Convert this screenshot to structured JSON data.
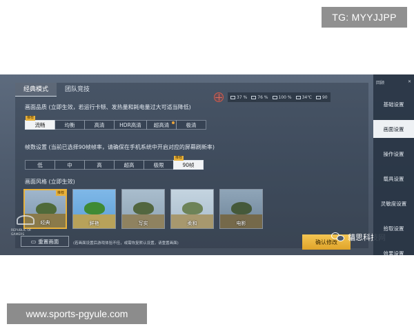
{
  "overlay": {
    "tg_badge": "TG: MYYJJPP",
    "site_badge": "www.sports-pgyule.com",
    "watermark": "貓思科技网"
  },
  "tabs": [
    {
      "label": "经典模式",
      "active": true
    },
    {
      "label": "团队竞技",
      "active": false
    }
  ],
  "hud": {
    "stats": [
      "37 %",
      "76 %",
      "100 %",
      "34℃",
      "90"
    ]
  },
  "quality": {
    "title": "画面品质 (立即生效，若运行卡顿、发热量和耗电量过大可适当降低)",
    "recommended_tag": "推荐",
    "options": [
      "流畅",
      "均衡",
      "高清",
      "HDR高清",
      "超高清",
      "极清"
    ],
    "selected": "流畅"
  },
  "framerate": {
    "title": "帧数设置 (当前已选择90帧帧率，请确保在手机系统中开启对应的屏幕刷新率)",
    "recommended_tag": "推荐",
    "options": [
      "低",
      "中",
      "高",
      "超高",
      "极限",
      "90帧"
    ],
    "selected": "90帧"
  },
  "style": {
    "title": "画面风格 (立即生效)",
    "recommended_tag": "推荐",
    "options": [
      "经典",
      "鲜艳",
      "写实",
      "柔和",
      "电影"
    ],
    "selected": "经典"
  },
  "footer": {
    "reset_label": "重置画面",
    "note": "(若画面设置后游戏体验不佳，或需恢复默认设置，请重置画面)",
    "confirm_label": "确认修改"
  },
  "brand": {
    "logo_text": "REPUBLIC OF GAMERS"
  },
  "sidebar": {
    "top_label": "回顾",
    "items": [
      "基础设置",
      "画面设置",
      "操作设置",
      "载具设置",
      "灵敏度设置",
      "拾取设置",
      "效果设置"
    ],
    "active": "画面设置"
  },
  "colors": {
    "accent": "#e8b23c",
    "panel": "#4d5a6c",
    "sidebar": "#28344a"
  }
}
